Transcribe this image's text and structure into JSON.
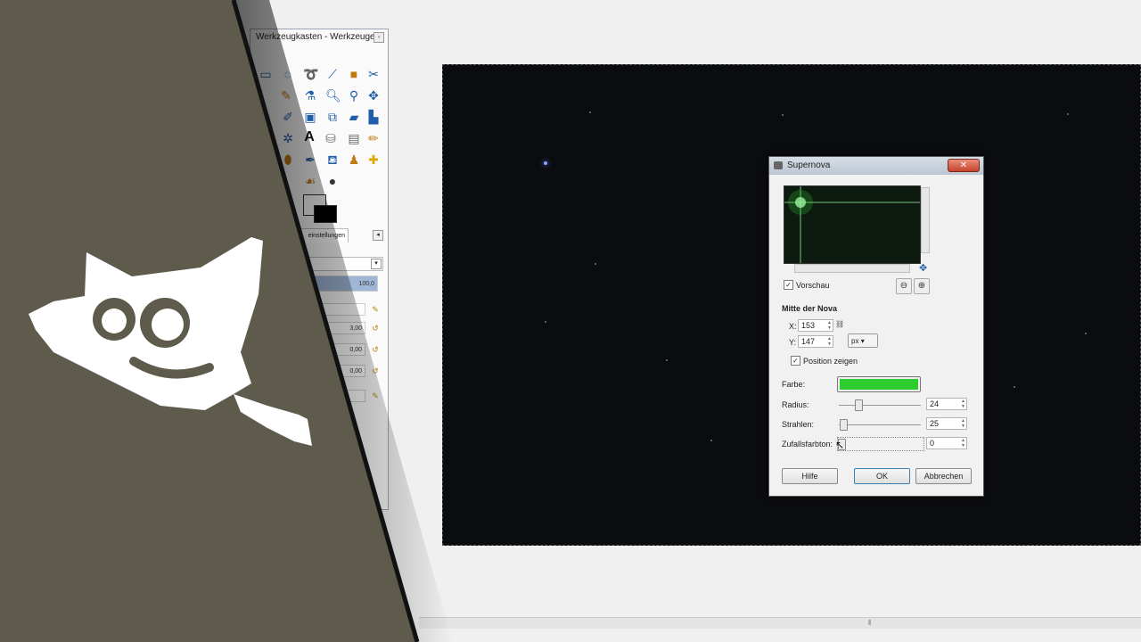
{
  "toolbox": {
    "title": "Werkzeugkasten - Werkzeugei...",
    "close_glyph": "▫",
    "tab_label": "einstellungen",
    "values": [
      "100,0",
      "3,00",
      "0,00",
      "0,00"
    ]
  },
  "dialog": {
    "title": "Supernova",
    "close_glyph": "✕",
    "preview_checkbox_label": "Vorschau",
    "section_title": "Mitte der Nova",
    "x_label": "X:",
    "x_value": "153",
    "y_label": "Y:",
    "y_value": "147",
    "unit": "px",
    "show_position_label": "Position zeigen",
    "color_label": "Farbe:",
    "color_value": "#2ecc2e",
    "radius_label": "Radius:",
    "radius_value": "24",
    "rays_label": "Strahlen:",
    "rays_value": "25",
    "random_hue_label": "Zufallsfarbton:",
    "random_hue_value": "0",
    "help_button": "Hilfe",
    "ok_button": "OK",
    "cancel_button": "Abbrechen"
  },
  "colors": {
    "brand_panel": "#5e5a4c",
    "canvas_bg": "#0b0c10",
    "accent_green": "#2ecc2e"
  }
}
